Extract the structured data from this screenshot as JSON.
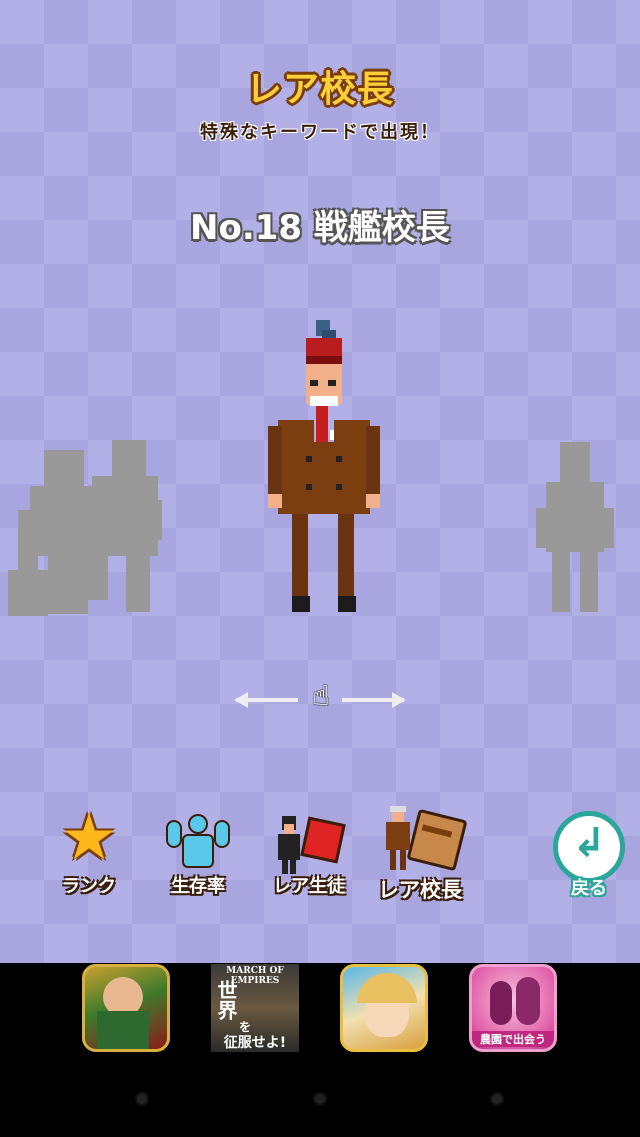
{
  "header": {
    "title": "レア校長",
    "subtitle": "特殊なキーワードで出現！"
  },
  "character": {
    "name": "No.18 戦艦校長"
  },
  "menu": {
    "rank_label": "ランク",
    "survival_label": "生存率",
    "rare_student_label": "レア生徒",
    "rare_principal_label": "レア校長",
    "back_label": "戻る"
  },
  "ads": [
    {
      "label": ""
    },
    {
      "title": "MARCH OF EMPIRES",
      "line1": "世界",
      "line2": "を",
      "line3": "征服せよ!"
    },
    {
      "label": ""
    },
    {
      "label": "農園で出会う"
    }
  ],
  "colors": {
    "background": "#b3b0e8",
    "accent_gold": "#ffcf3a",
    "back_teal": "#2aa69a",
    "silhouette": "#999999"
  }
}
